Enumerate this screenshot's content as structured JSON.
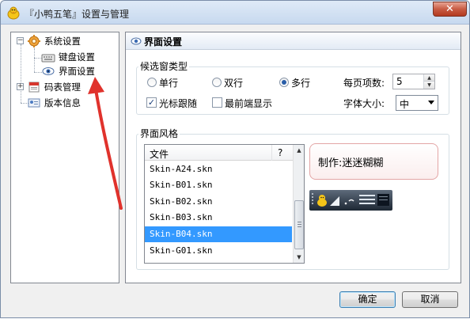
{
  "window": {
    "title": "『小鸭五笔』设置与管理",
    "close_glyph": "✕"
  },
  "tree": {
    "items": [
      {
        "label": "系统设置",
        "expander": "−",
        "icon": "gear-icon"
      },
      {
        "label": "键盘设置",
        "icon": "keyboard-icon"
      },
      {
        "label": "界面设置",
        "icon": "eye-icon"
      },
      {
        "label": "码表管理",
        "expander": "+",
        "icon": "book-icon"
      },
      {
        "label": "版本信息",
        "icon": "info-card-icon"
      }
    ]
  },
  "panel": {
    "title": "界面设置",
    "candidate_group": {
      "title": "候选窗类型",
      "options": [
        {
          "label": "单行",
          "checked": false
        },
        {
          "label": "双行",
          "checked": false
        },
        {
          "label": "多行",
          "checked": true
        }
      ],
      "per_page_label": "每页项数:",
      "per_page_value": "5",
      "follow_cursor_label": "光标跟随",
      "follow_cursor_checked": true,
      "topmost_label": "最前端显示",
      "topmost_checked": false,
      "font_size_label": "字体大小:",
      "font_size_value": "中"
    },
    "style_group": {
      "title": "界面风格",
      "columns": [
        "文件",
        "?"
      ],
      "rows": [
        "Skin-A24.skn",
        "Skin-B01.skn",
        "Skin-B02.skn",
        "Skin-B03.skn",
        "Skin-B04.skn",
        "Skin-G01.skn"
      ],
      "selected_index": 4,
      "preview_text": "制作:迷迷糊糊"
    }
  },
  "buttons": {
    "ok": "确定",
    "cancel": "取消"
  },
  "colors": {
    "selection": "#3399ff",
    "annotation_arrow": "#e0322c"
  }
}
